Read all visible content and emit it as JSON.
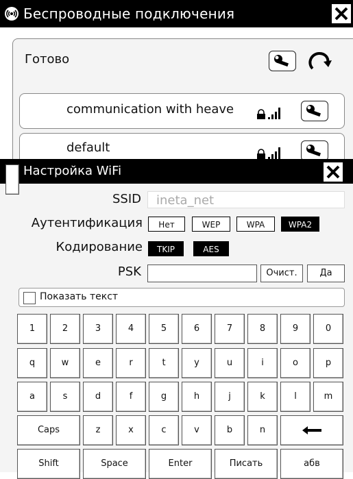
{
  "window": {
    "title": "Беспроводные подключения"
  },
  "main": {
    "status": "Готово",
    "networks": [
      {
        "name": "communication with heave"
      },
      {
        "name": "default"
      }
    ]
  },
  "dialog": {
    "title": "Настройка WiFi",
    "ssid_label": "SSID",
    "ssid_placeholder": "ineta_net",
    "auth_label": "Аутентификация",
    "auth_options": [
      "Нет",
      "WEP",
      "WPA",
      "WPA2"
    ],
    "auth_selected": "WPA2",
    "enc_label": "Кодирование",
    "enc_options": [
      "TKIP",
      "AES"
    ],
    "psk_label": "PSK",
    "clear_label": "Очист.",
    "ok_label": "Да",
    "show_text_label": "Показать текст"
  },
  "keyboard": {
    "row1": [
      "1",
      "2",
      "3",
      "4",
      "5",
      "6",
      "7",
      "8",
      "9",
      "0"
    ],
    "row2": [
      "q",
      "w",
      "e",
      "r",
      "t",
      "y",
      "u",
      "i",
      "o",
      "p"
    ],
    "row3": [
      "a",
      "s",
      "d",
      "f",
      "g",
      "h",
      "j",
      "k",
      "l",
      "m"
    ],
    "row4": [
      "Caps",
      "z",
      "x",
      "c",
      "v",
      "b",
      "n"
    ],
    "row5": [
      "Shift",
      "Space",
      "Enter",
      "Писать",
      "абв"
    ]
  }
}
